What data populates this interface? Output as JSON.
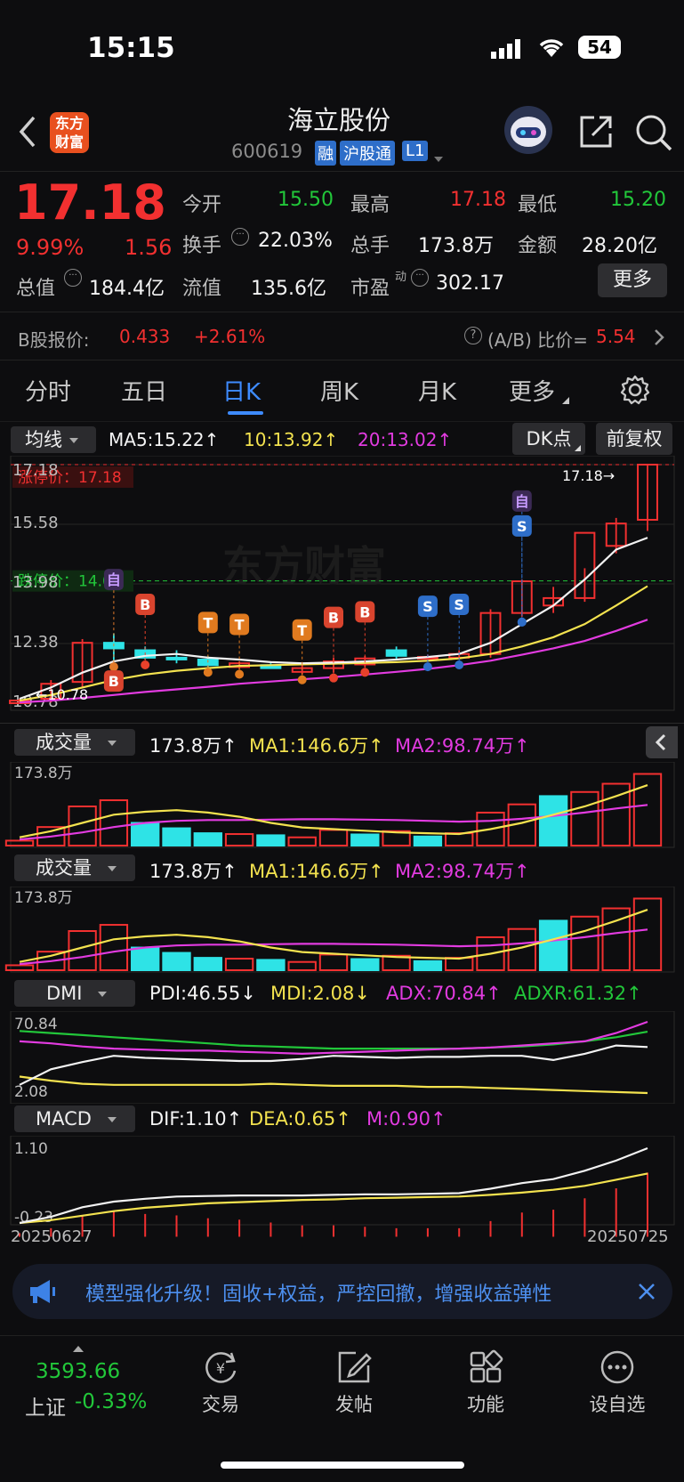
{
  "status_bar": {
    "time": "15:15",
    "battery": "54"
  },
  "header": {
    "logo_line1": "东方",
    "logo_line2": "财富",
    "title": "海立股份",
    "code": "600619",
    "badge_rong": "融",
    "badge_hgt": "沪股通",
    "badge_l1": "L1"
  },
  "quote": {
    "price": "17.18",
    "change_pct": "9.99%",
    "change": "1.56",
    "open_label": "今开",
    "open": "15.50",
    "high_label": "最高",
    "high": "17.18",
    "low_label": "最低",
    "low": "15.20",
    "turnover_label": "换手",
    "turnover": "22.03%",
    "volume_label": "总手",
    "volume": "173.8万",
    "amount_label": "金额",
    "amount": "28.20亿",
    "mktcap_label": "总值",
    "mktcap": "184.4亿",
    "float_label": "流值",
    "float_cap": "135.6亿",
    "pe_label": "市盈",
    "pe_sup": "动",
    "pe": "302.17",
    "more_button": "更多"
  },
  "b_share": {
    "label": "B股报价:",
    "price": "0.433",
    "change": "+2.61%",
    "ratio_label": "(A/B) 比价=",
    "ratio": "5.54"
  },
  "tabs": [
    "分时",
    "五日",
    "日K",
    "周K",
    "月K",
    "更多"
  ],
  "active_tab": "日K",
  "main_chart": {
    "selector": "均线",
    "ma5": "MA5:15.22",
    "ma10": "10:13.92",
    "ma20": "20:13.02",
    "dk_button": "DK点",
    "fq_button": "前复权",
    "y_top": "17.18",
    "y_2": "15.58",
    "y_3": "13.98",
    "y_4": "12.38",
    "y_5": "10.78",
    "limit_up_label": "涨停价：17.18",
    "limit_down_label": "跌停价：14.06",
    "max_marker": "17.18→",
    "min_marker": "←10.78",
    "watermark": "东方财富",
    "tag_zi": "自",
    "tag_b": "B",
    "tag_t": "T",
    "tag_s": "S"
  },
  "volume_panel_1": {
    "selector": "成交量",
    "value": "173.8万",
    "ma1": "MA1:146.6万",
    "ma2": "MA2:98.74万",
    "y_top": "173.8万"
  },
  "volume_panel_2": {
    "selector": "成交量",
    "value": "173.8万",
    "ma1": "MA1:146.6万",
    "ma2": "MA2:98.74万",
    "y_top": "173.8万"
  },
  "dmi_panel": {
    "selector": "DMI",
    "pdi": "PDI:46.55",
    "mdi": "MDI:2.08",
    "adx": "ADX:70.84",
    "adxr": "ADXR:61.32",
    "y_top": "70.84",
    "y_bottom": "2.08"
  },
  "macd_panel": {
    "selector": "MACD",
    "dif": "DIF:1.10",
    "dea": "DEA:0.65",
    "m": "M:0.90",
    "y_top": "1.10",
    "y_bottom": "-0.23",
    "date_start": "20250627",
    "date_end": "20250725"
  },
  "banner": {
    "text": "模型强化升级！固收+权益，严控回撤，增强收益弹性"
  },
  "bottom_nav": {
    "index_value": "3593.66",
    "index_name": "上证",
    "index_change": "-0.33%",
    "items": [
      "交易",
      "发帖",
      "功能",
      "设自选"
    ]
  },
  "chart_data": {
    "type": "candlestick",
    "title": "",
    "x_start": "20250627",
    "x_end": "20250725",
    "ylim": [
      10.78,
      17.18
    ],
    "candles": [
      {
        "o": 10.78,
        "h": 10.9,
        "l": 10.78,
        "c": 10.85
      },
      {
        "o": 10.9,
        "h": 11.4,
        "l": 10.8,
        "c": 11.3
      },
      {
        "o": 11.35,
        "h": 12.5,
        "l": 11.2,
        "c": 12.4
      },
      {
        "o": 12.4,
        "h": 12.65,
        "l": 11.9,
        "c": 12.25
      },
      {
        "o": 12.2,
        "h": 12.3,
        "l": 11.95,
        "c": 12.0
      },
      {
        "o": 12.0,
        "h": 12.2,
        "l": 11.85,
        "c": 11.98
      },
      {
        "o": 11.95,
        "h": 12.05,
        "l": 11.75,
        "c": 11.8
      },
      {
        "o": 11.75,
        "h": 11.9,
        "l": 11.7,
        "c": 11.85
      },
      {
        "o": 11.8,
        "h": 11.85,
        "l": 11.7,
        "c": 11.72
      },
      {
        "o": 11.62,
        "h": 11.82,
        "l": 11.55,
        "c": 11.72
      },
      {
        "o": 11.72,
        "h": 12.0,
        "l": 11.6,
        "c": 11.9
      },
      {
        "o": 11.82,
        "h": 12.05,
        "l": 11.75,
        "c": 11.98
      },
      {
        "o": 12.2,
        "h": 12.3,
        "l": 11.95,
        "c": 12.05
      },
      {
        "o": 11.98,
        "h": 12.08,
        "l": 11.9,
        "c": 12.02
      },
      {
        "o": 12.0,
        "h": 12.2,
        "l": 11.95,
        "c": 12.1
      },
      {
        "o": 12.1,
        "h": 13.3,
        "l": 12.0,
        "c": 13.2
      },
      {
        "o": 13.2,
        "h": 14.1,
        "l": 13.1,
        "c": 14.05
      },
      {
        "o": 13.4,
        "h": 13.9,
        "l": 13.2,
        "c": 13.6
      },
      {
        "o": 13.6,
        "h": 14.4,
        "l": 13.5,
        "c": 15.35
      },
      {
        "o": 15.0,
        "h": 15.75,
        "l": 14.8,
        "c": 15.6
      },
      {
        "o": 15.7,
        "h": 17.18,
        "l": 15.4,
        "c": 17.18
      }
    ],
    "ma5": [
      10.9,
      11.2,
      11.6,
      11.9,
      12.05,
      12.1,
      12.0,
      11.95,
      11.88,
      11.85,
      11.87,
      11.9,
      11.95,
      12.02,
      12.1,
      12.4,
      12.9,
      13.4,
      14.1,
      14.9,
      15.22
    ],
    "ma10": [
      10.85,
      11.0,
      11.2,
      11.4,
      11.55,
      11.65,
      11.72,
      11.78,
      11.8,
      11.82,
      11.84,
      11.86,
      11.88,
      11.92,
      11.98,
      12.1,
      12.3,
      12.55,
      12.9,
      13.4,
      13.92
    ],
    "ma20": [
      10.8,
      10.85,
      10.92,
      11.0,
      11.08,
      11.15,
      11.22,
      11.3,
      11.36,
      11.42,
      11.48,
      11.55,
      11.62,
      11.7,
      11.8,
      11.92,
      12.08,
      12.25,
      12.45,
      12.72,
      13.02
    ],
    "volume_wan": [
      12,
      45,
      95,
      110,
      55,
      42,
      30,
      28,
      25,
      20,
      38,
      27,
      35,
      22,
      30,
      80,
      100,
      120,
      130,
      150,
      173.8
    ],
    "volume_up": [
      true,
      true,
      true,
      true,
      false,
      false,
      false,
      true,
      false,
      true,
      true,
      false,
      true,
      false,
      true,
      true,
      true,
      false,
      true,
      true,
      true
    ],
    "vol_ma1": [
      20,
      35,
      55,
      75,
      82,
      86,
      80,
      70,
      55,
      44,
      40,
      36,
      32,
      30,
      28,
      40,
      55,
      75,
      95,
      120,
      146.6
    ],
    "vol_ma2": [
      15,
      22,
      32,
      45,
      55,
      60,
      62,
      62,
      63,
      64,
      64,
      63,
      62,
      60,
      58,
      60,
      65,
      72,
      80,
      90,
      98.74
    ],
    "dmi_pdi": [
      10,
      25,
      32,
      38,
      36,
      35,
      34,
      33,
      33,
      35,
      38,
      37,
      36,
      37,
      37,
      38,
      38,
      34,
      40,
      48,
      46.55
    ],
    "dmi_mdi": [
      18,
      14,
      11,
      10,
      10,
      10,
      10,
      10,
      11,
      10,
      9,
      9,
      9,
      8,
      8,
      7,
      6,
      5,
      4,
      3,
      2.08
    ],
    "dmi_adx": [
      52,
      50,
      47,
      45,
      44,
      43,
      43,
      42,
      41,
      40,
      41,
      42,
      43,
      44,
      45,
      46,
      48,
      50,
      52,
      60,
      70.84
    ],
    "dmi_adxr": [
      62,
      60,
      58,
      56,
      54,
      52,
      50,
      48,
      47,
      46,
      45,
      45,
      45,
      45,
      45,
      46,
      47,
      49,
      52,
      56,
      61.32
    ],
    "macd_dif": [
      -0.23,
      -0.12,
      0.05,
      0.15,
      0.2,
      0.24,
      0.25,
      0.26,
      0.26,
      0.26,
      0.27,
      0.28,
      0.28,
      0.29,
      0.3,
      0.38,
      0.48,
      0.55,
      0.7,
      0.88,
      1.1
    ],
    "macd_dea": [
      -0.23,
      -0.18,
      -0.1,
      -0.02,
      0.04,
      0.08,
      0.12,
      0.14,
      0.16,
      0.18,
      0.19,
      0.21,
      0.22,
      0.23,
      0.24,
      0.27,
      0.31,
      0.36,
      0.43,
      0.54,
      0.65
    ],
    "macd_m": [
      0.05,
      0.12,
      0.3,
      0.35,
      0.32,
      0.3,
      0.26,
      0.24,
      0.2,
      0.16,
      0.16,
      0.14,
      0.12,
      0.12,
      0.12,
      0.22,
      0.34,
      0.38,
      0.54,
      0.68,
      0.9
    ]
  }
}
